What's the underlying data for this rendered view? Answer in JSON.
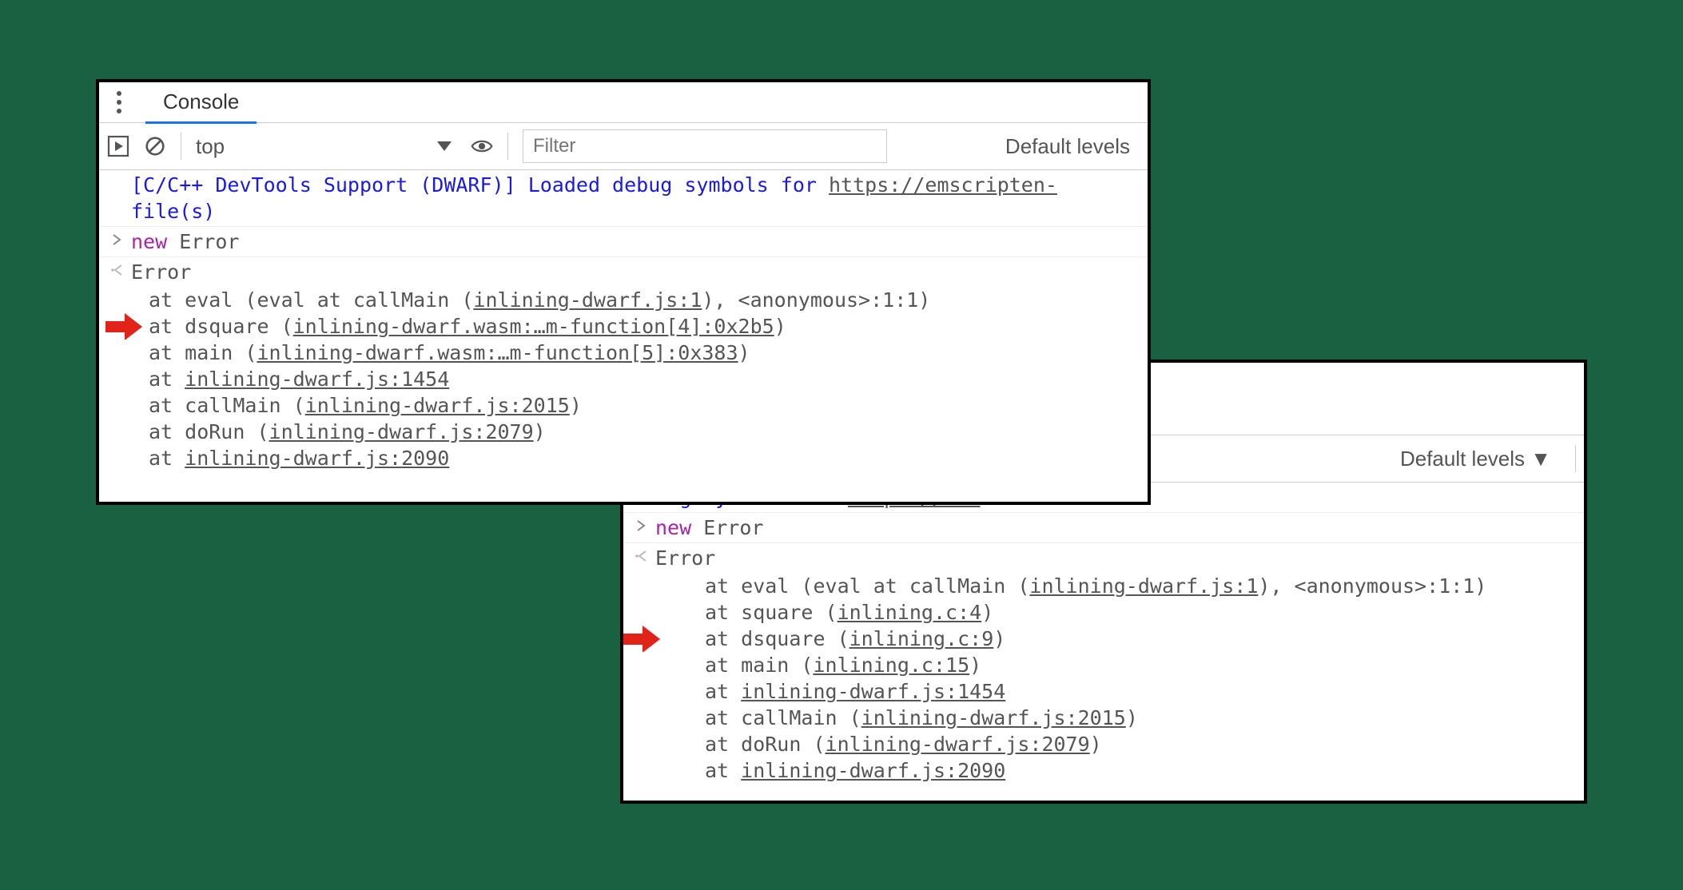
{
  "panel1": {
    "tab": "Console",
    "context": "top",
    "filter_placeholder": "Filter",
    "levels": "Default levels",
    "info_msg_prefix": "[C/C++ DevTools Support (DWARF)] Loaded debug symbols for ",
    "info_msg_link": "https://emscripten-",
    "info_msg_suffix": "file(s)",
    "input_new": "new",
    "input_error": " Error",
    "error_header": "Error",
    "lines": {
      "l0": "    at eval (eval at callMain (",
      "l0_link": "inlining-dwarf.js:1",
      "l0_tail": "), <anonymous>:1:1)",
      "l1": "    at dsquare (",
      "l1_link": "inlining-dwarf.wasm:…m-function[4]:0x2b5",
      "l1_tail": ")",
      "l2": "    at main (",
      "l2_link": "inlining-dwarf.wasm:…m-function[5]:0x383",
      "l2_tail": ")",
      "l3": "    at ",
      "l3_link": "inlining-dwarf.js:1454",
      "l4": "    at callMain (",
      "l4_link": "inlining-dwarf.js:2015",
      "l4_tail": ")",
      "l5": "    at doRun (",
      "l5_link": "inlining-dwarf.js:2079",
      "l5_tail": ")",
      "l6": "    at ",
      "l6_link": "inlining-dwarf.js:2090"
    }
  },
  "panel2": {
    "filter_placeholder": "",
    "levels": "Default levels ▼",
    "info_msg_prefix": "debug symbols for ",
    "info_msg_link": "https://ems",
    "input_new": "new",
    "input_error": " Error",
    "error_header": "Error",
    "lines": {
      "l0": "    at eval (eval at callMain (",
      "l0_link": "inlining-dwarf.js:1",
      "l0_tail": "), <anonymous>:1:1)",
      "l1": "    at square (",
      "l1_link": "inlining.c:4",
      "l1_tail": ")",
      "l2": "    at dsquare (",
      "l2_link": "inlining.c:9",
      "l2_tail": ")",
      "l3": "    at main (",
      "l3_link": "inlining.c:15",
      "l3_tail": ")",
      "l4": "    at ",
      "l4_link": "inlining-dwarf.js:1454",
      "l5": "    at callMain (",
      "l5_link": "inlining-dwarf.js:2015",
      "l5_tail": ")",
      "l6": "    at doRun (",
      "l6_link": "inlining-dwarf.js:2079",
      "l6_tail": ")",
      "l7": "    at ",
      "l7_link": "inlining-dwarf.js:2090"
    }
  }
}
